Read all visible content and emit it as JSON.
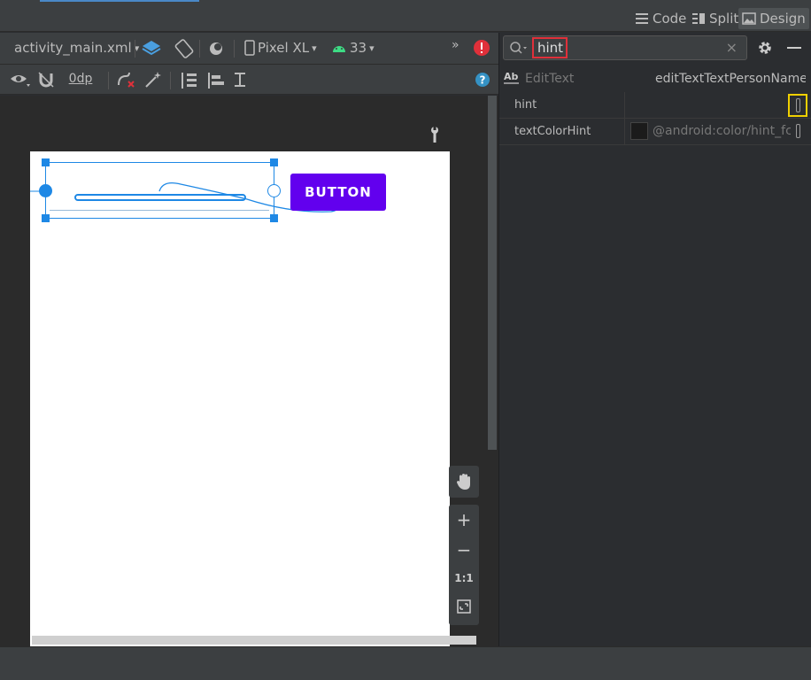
{
  "view_modes": {
    "code": "Code",
    "split": "Split",
    "design": "Design"
  },
  "toolbar": {
    "file_name": "activity_main.xml",
    "device": "Pixel XL",
    "api_level": "33",
    "margin": "0dp",
    "overflow": "»"
  },
  "preview": {
    "button_label": "BUTTON",
    "zoom_reset_label": "1:1"
  },
  "attributes": {
    "search_value": "hint",
    "search_clear": "×",
    "component_type": "EditText",
    "component_id": "editTextTextPersonName",
    "rows": [
      {
        "name": "hint",
        "value": ""
      },
      {
        "name": "textColorHint",
        "value": "@android:color/hint_fc"
      }
    ]
  },
  "colors": {
    "accent": "#1e88e5",
    "button": "#6200ee",
    "error": "#e0303a",
    "highlight": "#f0d000",
    "android_green": "#3ddc84"
  }
}
